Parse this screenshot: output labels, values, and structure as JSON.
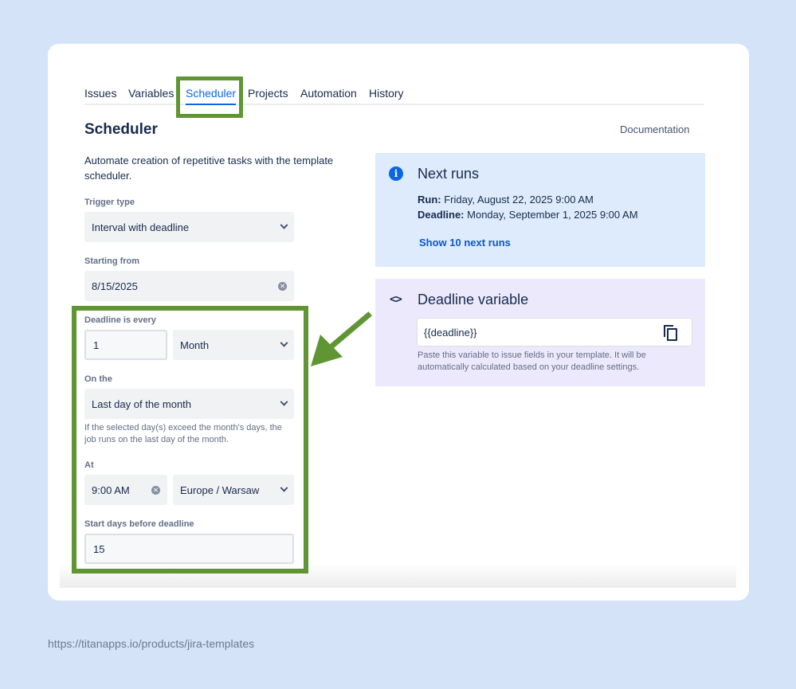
{
  "tabs": [
    {
      "label": "Issues"
    },
    {
      "label": "Variables"
    },
    {
      "label": "Scheduler",
      "active": true
    },
    {
      "label": "Projects"
    },
    {
      "label": "Automation"
    },
    {
      "label": "History"
    }
  ],
  "page": {
    "title": "Scheduler",
    "documentation_link": "Documentation",
    "description": "Automate creation of repetitive tasks with the template scheduler."
  },
  "form": {
    "trigger_type": {
      "label": "Trigger type",
      "value": "Interval with deadline"
    },
    "starting_from": {
      "label": "Starting from",
      "value": "8/15/2025"
    },
    "deadline_every": {
      "label": "Deadline is every",
      "number": "1",
      "unit": "Month"
    },
    "on_the": {
      "label": "On the",
      "value": "Last day of the month",
      "help": "If the selected day(s) exceed the month's days, the job runs on the last day of the month."
    },
    "at": {
      "label": "At",
      "time": "9:00 AM",
      "timezone": "Europe / Warsaw"
    },
    "start_days_before": {
      "label": "Start days before deadline",
      "value": "15"
    }
  },
  "next_runs": {
    "title": "Next runs",
    "run_label": "Run:",
    "run_value": "Friday, August 22, 2025 9:00 AM",
    "deadline_label": "Deadline:",
    "deadline_value": "Monday, September 1, 2025 9:00 AM",
    "show_link": "Show 10 next runs"
  },
  "deadline_variable": {
    "title": "Deadline variable",
    "variable": "{{deadline}}",
    "help": "Paste this variable to issue fields in your template. It will be automatically calculated based on your deadline settings."
  },
  "footer": {
    "url": "https://titanapps.io/products/jira-templates"
  },
  "colors": {
    "background": "#d4e3f8",
    "highlight_green": "#5f9633",
    "accent_blue": "#0c66e4",
    "next_runs_bg": "#deebfc",
    "deadline_bg": "#ece9fd"
  },
  "icons": {
    "info": "info-icon",
    "code": "code-icon",
    "copy": "copy-icon",
    "clear": "clear-icon",
    "chevron": "chevron-down-icon",
    "arrow": "arrow-annotation-icon"
  }
}
